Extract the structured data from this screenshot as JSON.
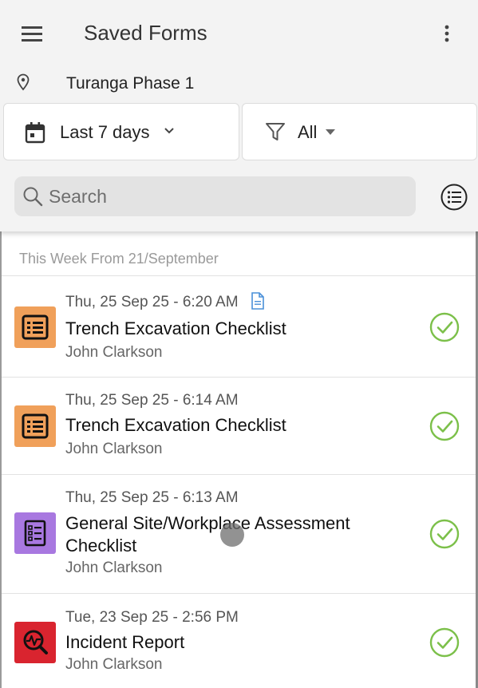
{
  "app_bar": {
    "title": "Saved Forms",
    "menu_icon": "hamburger-menu-icon",
    "more_icon": "more-vertical-icon"
  },
  "location": {
    "icon": "map-pin-icon",
    "name": "Turanga Phase 1"
  },
  "filters": {
    "date_range": {
      "icon": "calendar-icon",
      "label": "Last 7 days",
      "dropdown_icon": "chevron-down-icon"
    },
    "form_type": {
      "icon": "funnel-icon",
      "label": "All",
      "dropdown_icon": "caret-down-icon"
    }
  },
  "search": {
    "placeholder": "Search",
    "icon": "search-icon",
    "list_view_icon": "list-view-icon"
  },
  "section": {
    "header": "This Week From 21/September"
  },
  "colors": {
    "checklist_orange": "#f0a05a",
    "assessment_purple": "#a878e0",
    "incident_red": "#d9242f",
    "status_green": "#7cc04a",
    "doc_blue": "#4a90d9"
  },
  "forms": [
    {
      "date": "Thu, 25 Sep 25 - 6:20 AM",
      "title": "Trench Excavation Checklist",
      "author": "John Clarkson",
      "icon": "checklist-icon",
      "has_attachment": true,
      "status": "completed"
    },
    {
      "date": "Thu, 25 Sep 25 - 6:14 AM",
      "title": "Trench Excavation Checklist",
      "author": "John Clarkson",
      "icon": "checklist-icon",
      "status": "completed"
    },
    {
      "date": "Thu, 25 Sep 25 - 6:13 AM",
      "title_line1": "General Site/Workplace Assessment",
      "title_line2": "Checklist",
      "author": "John Clarkson",
      "icon": "assessment-checklist-icon",
      "status": "completed"
    },
    {
      "date": "Tue, 23 Sep 25 - 2:56 PM",
      "title": "Incident Report",
      "author": "John Clarkson",
      "icon": "incident-icon",
      "status": "completed"
    }
  ]
}
